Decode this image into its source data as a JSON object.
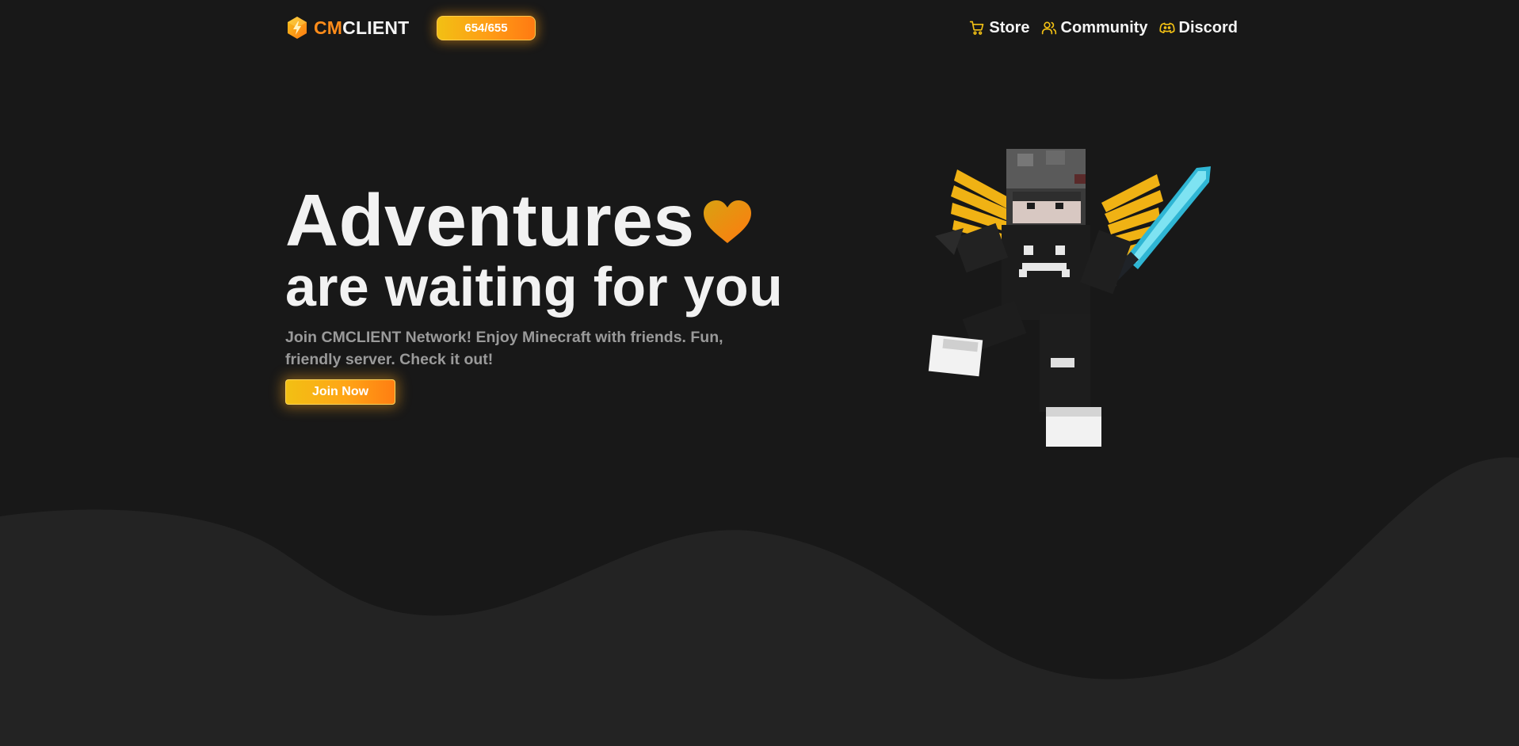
{
  "brand": {
    "name_accent": "CM",
    "name_rest": "CLIENT",
    "logo_icon": "hexagon-lightning-logo",
    "accent_color": "#ff8c1a"
  },
  "header": {
    "players_online": "654/655"
  },
  "nav": {
    "items": [
      {
        "label": "Store",
        "icon": "cart-icon"
      },
      {
        "label": "Community",
        "icon": "users-icon"
      },
      {
        "label": "Discord",
        "icon": "discord-icon"
      }
    ]
  },
  "hero": {
    "title": "Adventures",
    "subtitle": "are waiting for you",
    "description": "Join CMCLIENT Network! Enjoy Minecraft with friends. Fun, friendly server. Check it out!",
    "cta_label": "Join Now"
  },
  "theme": {
    "background": "#181818",
    "wave": "#232323",
    "gradient_start": "#f2c014",
    "gradient_end": "#ff7a12",
    "icon_color": "#f2c014"
  }
}
